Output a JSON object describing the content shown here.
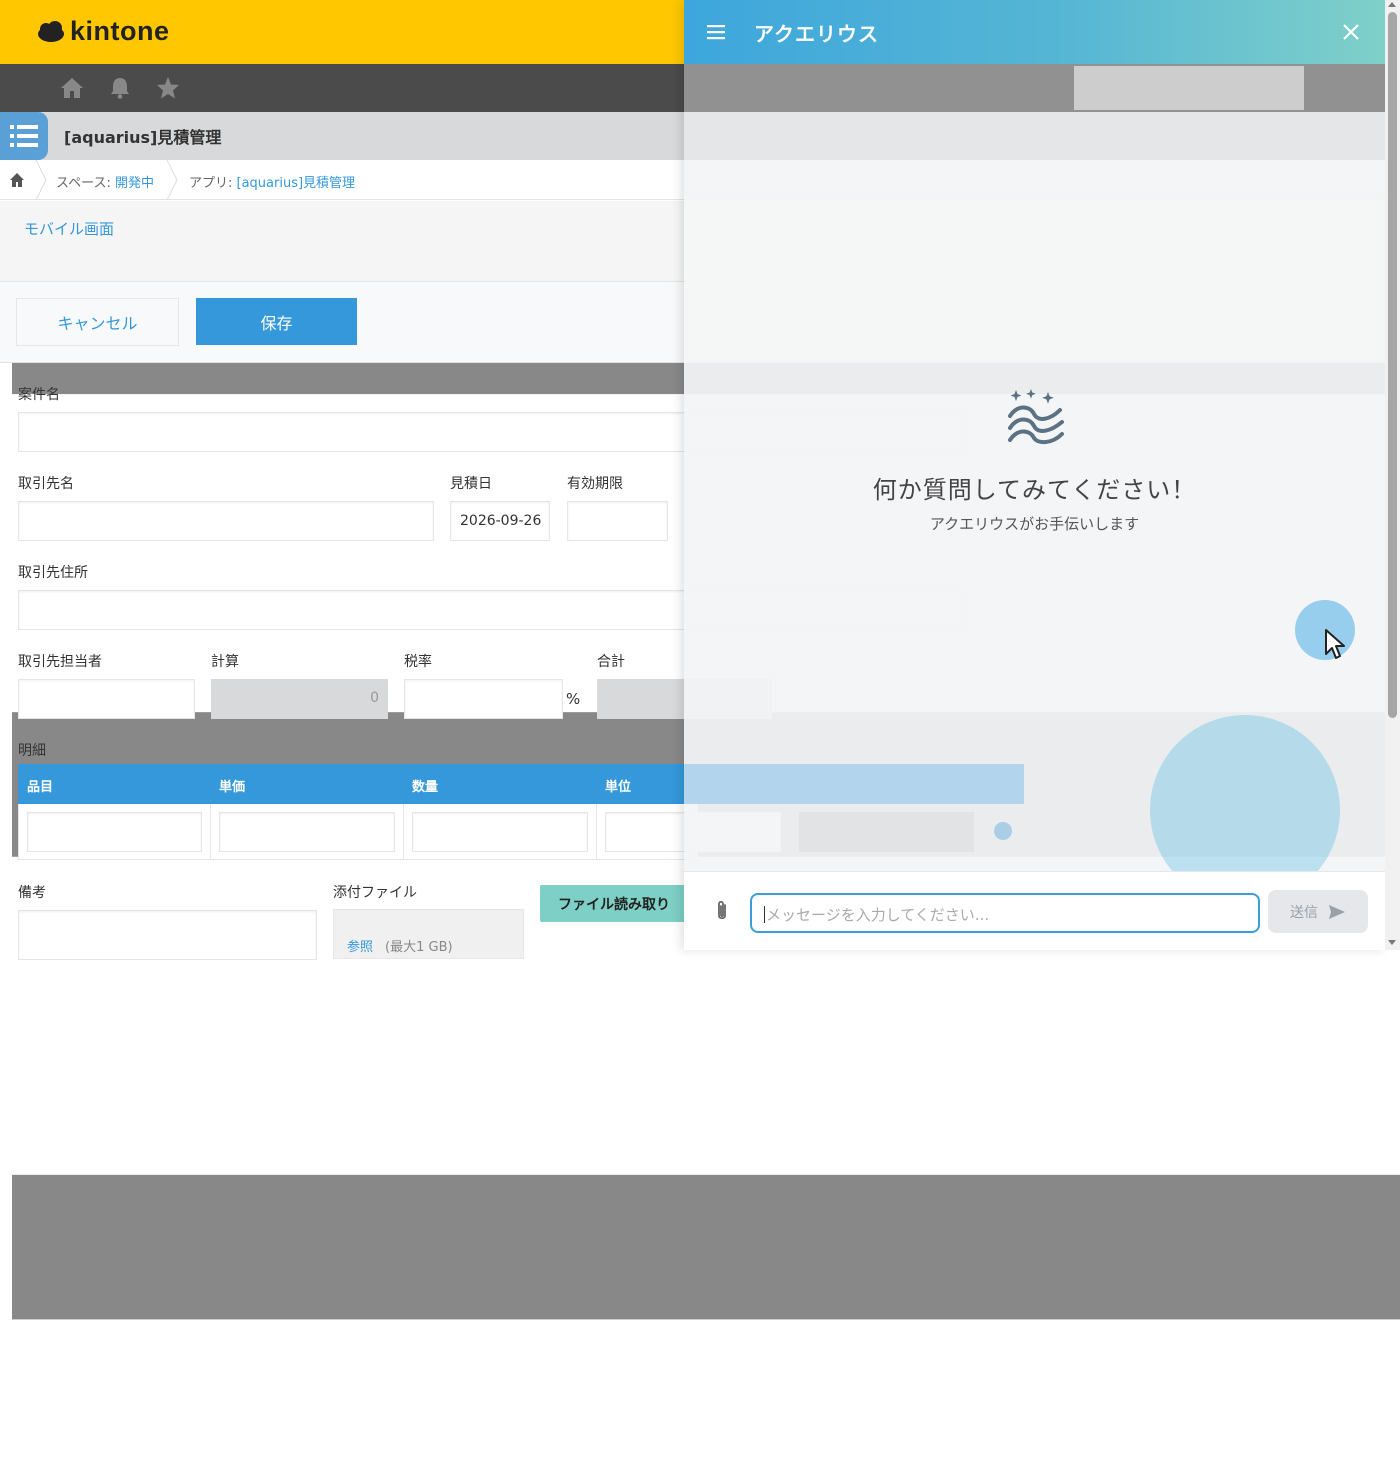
{
  "header": {
    "logo_text": "kintone"
  },
  "app": {
    "title": "[aquarius]見積管理"
  },
  "breadcrumb": {
    "space_prefix": "スペース: ",
    "space_name": "開発中",
    "app_prefix": "アプリ: ",
    "app_name": "[aquarius]見積管理"
  },
  "subbar": {
    "mobile_link": "モバイル画面"
  },
  "actions": {
    "cancel_label": "キャンセル",
    "save_label": "保存"
  },
  "form": {
    "project_name_label": "案件名",
    "client_name_label": "取引先名",
    "estimate_date_label": "見積日",
    "estimate_date_value": "2026-09-26",
    "expiry_label": "有効期限",
    "client_address_label": "取引先住所",
    "client_contact_label": "取引先担当者",
    "calc_label": "計算",
    "calc_value": "0",
    "tax_rate_label": "税率",
    "tax_unit": "%",
    "total_label": "合計",
    "details_label": "明細",
    "details_columns": [
      "品目",
      "単価",
      "数量",
      "単位"
    ],
    "remarks_label": "備考",
    "attachment_label": "添付ファイル",
    "file_read_button": "ファイル読み取り",
    "browse_label": "参照",
    "max_size_note": "(最大1 GB)"
  },
  "chat": {
    "title": "アクエリウス",
    "empty_title": "何か質問してみてください！",
    "empty_subtitle": "アクエリウスがお手伝いします",
    "input_placeholder": "メッセージを入力してください...",
    "send_label": "送信"
  },
  "colors": {
    "kintone_yellow": "#fec700",
    "accent_blue": "#3498db",
    "chat_gradient_start": "#3da6dc",
    "chat_gradient_end": "#7fd0c9"
  }
}
